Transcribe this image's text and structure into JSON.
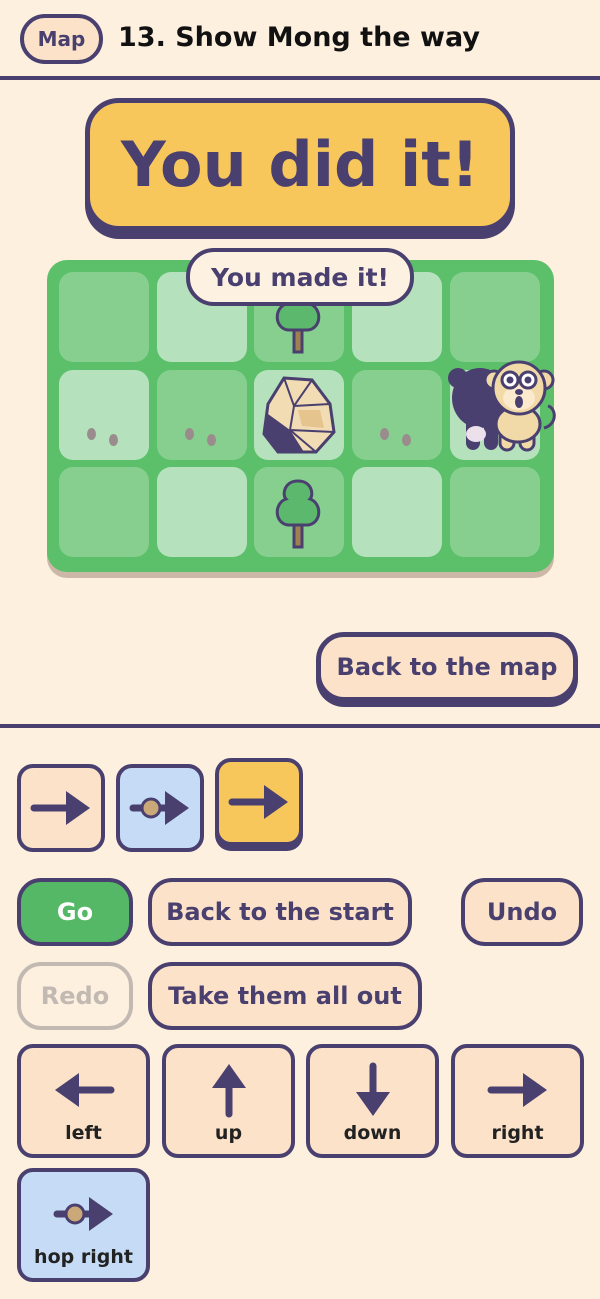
{
  "header": {
    "map_label": "Map",
    "title": "13. Show Mong the way"
  },
  "banner": "You did it!",
  "board": {
    "bubble": "You made it!",
    "rows": 3,
    "cols": 5
  },
  "back_to_map": "Back to the map",
  "program": [
    {
      "icon": "right-arrow-icon",
      "color": "#fbe2c8"
    },
    {
      "icon": "hop-right-icon",
      "color": "#c6dcf6"
    },
    {
      "icon": "right-arrow-icon",
      "color": "#f7c75c"
    }
  ],
  "controls": {
    "go": "Go",
    "back_to_start": "Back to the start",
    "undo": "Undo",
    "redo": "Redo",
    "take_all_out": "Take them all out"
  },
  "moves": [
    {
      "label": "left",
      "icon": "left-arrow-icon"
    },
    {
      "label": "up",
      "icon": "up-arrow-icon"
    },
    {
      "label": "down",
      "icon": "down-arrow-icon"
    },
    {
      "label": "right",
      "icon": "right-arrow-icon"
    },
    {
      "label": "hop right",
      "icon": "hop-right-icon"
    }
  ]
}
